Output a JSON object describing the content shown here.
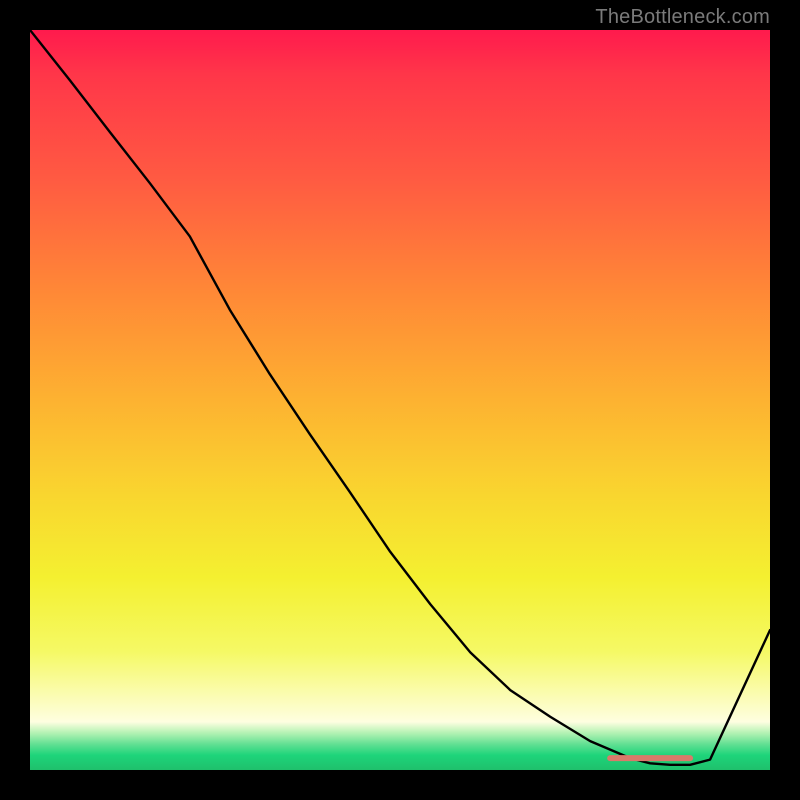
{
  "watermark": "TheBottleneck.com",
  "chart_data": {
    "type": "line",
    "title": "",
    "xlabel": "",
    "ylabel": "",
    "xlim": [
      0,
      100
    ],
    "ylim": [
      0,
      100
    ],
    "grid": false,
    "legend": false,
    "series": [
      {
        "name": "curve",
        "color": "#000000",
        "x": [
          0,
          5.4,
          10.8,
          16.2,
          21.6,
          27.0,
          32.4,
          37.8,
          43.2,
          48.6,
          54.1,
          59.5,
          64.9,
          70.3,
          75.7,
          81.1,
          83.8,
          86.5,
          89.2,
          91.9,
          100
        ],
        "values": [
          100,
          93.2,
          86.2,
          79.3,
          72.1,
          62.2,
          53.5,
          45.4,
          37.6,
          29.6,
          22.4,
          15.9,
          10.8,
          7.2,
          3.9,
          1.6,
          0.9,
          0.7,
          0.7,
          1.4,
          18.9
        ]
      },
      {
        "name": "highlight-segment",
        "color": "#d97a6a",
        "x": [
          78.4,
          89.2
        ],
        "values": [
          1.6,
          1.6
        ]
      }
    ],
    "gradient_stops": [
      {
        "pct": 0,
        "color": "#ff1a4d"
      },
      {
        "pct": 6,
        "color": "#ff3649"
      },
      {
        "pct": 20,
        "color": "#ff5a42"
      },
      {
        "pct": 36,
        "color": "#ff8a36"
      },
      {
        "pct": 50,
        "color": "#fdb231"
      },
      {
        "pct": 63,
        "color": "#f9d62f"
      },
      {
        "pct": 74,
        "color": "#f4f030"
      },
      {
        "pct": 84,
        "color": "#f5f965"
      },
      {
        "pct": 90,
        "color": "#fbfcb3"
      },
      {
        "pct": 93.5,
        "color": "#fefee0"
      },
      {
        "pct": 95,
        "color": "#b3f2b3"
      },
      {
        "pct": 96.5,
        "color": "#62e093"
      },
      {
        "pct": 98,
        "color": "#1ed47a"
      },
      {
        "pct": 100,
        "color": "#1fc06c"
      }
    ]
  }
}
